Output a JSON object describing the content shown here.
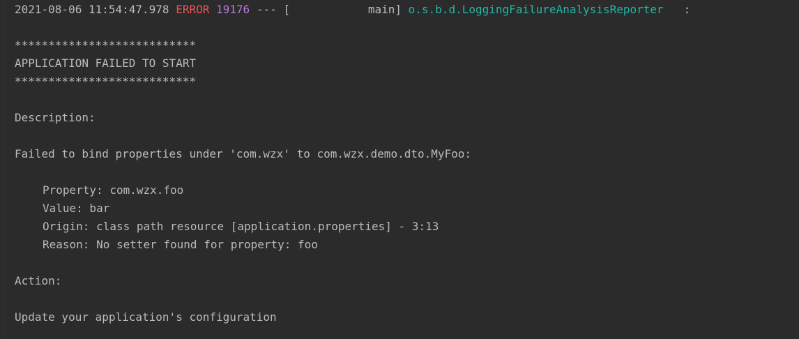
{
  "log_header": {
    "timestamp": "2021-08-06 11:54:47.978",
    "level": "ERROR",
    "pid": "19176",
    "separator": "--- [",
    "thread": "main]",
    "logger": "o.s.b.d.LoggingFailureAnalysisReporter",
    "colon": ":"
  },
  "banner": {
    "stars_top": "***************************",
    "title": "APPLICATION FAILED TO START",
    "stars_bottom": "***************************"
  },
  "description": {
    "heading": "Description:",
    "message": "Failed to bind properties under 'com.wzx' to com.wzx.demo.dto.MyFoo:",
    "details": [
      "Property: com.wzx.foo",
      "Value: bar",
      "Origin: class path resource [application.properties] - 3:13",
      "Reason: No setter found for property: foo"
    ]
  },
  "action": {
    "heading": "Action:",
    "message": "Update your application's configuration"
  },
  "colors": {
    "background": "#2b2b2b",
    "text": "#bbbbbb",
    "error": "#f0524f",
    "pid": "#b877db",
    "logger": "#21b8a8"
  }
}
